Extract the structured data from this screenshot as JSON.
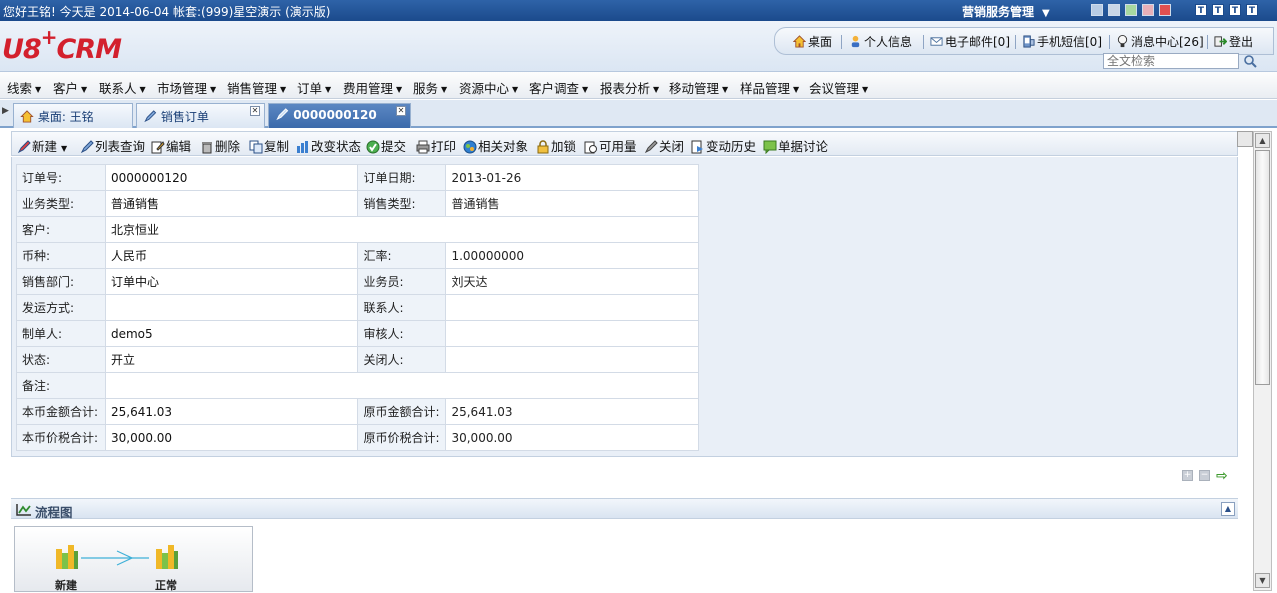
{
  "topbar": {
    "greeting": "您好王铭!   今天是  2014-06-04 帐套:(999)星空演示  (演示版)",
    "module": "营销服务管理",
    "module_arrow": "▼",
    "window_buttons": [
      "T",
      "T",
      "T",
      "T"
    ]
  },
  "header": {
    "logo_main": "U8",
    "logo_plus": "+",
    "logo_crm": "CRM",
    "links": [
      "桌面",
      "个人信息",
      "电子邮件[0]",
      "手机短信[0]",
      "消息中心[26]",
      "登出"
    ],
    "search_placeholder": "全文检索"
  },
  "menu": {
    "items": [
      "线索",
      "客户",
      "联系人",
      "市场管理",
      "销售管理",
      "订单",
      "费用管理",
      "服务",
      "资源中心",
      "客户调查",
      "报表分析",
      "移动管理",
      "样品管理",
      "会议管理"
    ]
  },
  "tabs": [
    {
      "label": "桌面: 王铭"
    },
    {
      "label": "销售订单"
    },
    {
      "label": "0000000120"
    }
  ],
  "toolbar": {
    "items": [
      "新建",
      "列表查询",
      "编辑",
      "删除",
      "复制",
      "改变状态",
      "提交",
      "打印",
      "相关对象",
      "加锁",
      "可用量",
      "关闭",
      "变动历史",
      "单据讨论"
    ]
  },
  "form": {
    "order_no_label": "订单号:",
    "order_no": "0000000120",
    "order_date_label": "订单日期:",
    "order_date": "2013-01-26",
    "biz_type_label": "业务类型:",
    "biz_type": "普通销售",
    "sale_type_label": "销售类型:",
    "sale_type": "普通销售",
    "customer_label": "客户:",
    "customer": "北京恒业",
    "currency_label": "币种:",
    "currency": "人民币",
    "rate_label": "汇率:",
    "rate": "1.00000000",
    "dept_label": "销售部门:",
    "dept": "订单中心",
    "salesman_label": "业务员:",
    "salesman": "刘天达",
    "ship_label": "发运方式:",
    "ship": "",
    "contact_label": "联系人:",
    "contact": "",
    "maker_label": "制单人:",
    "maker": "demo5",
    "auditor_label": "审核人:",
    "auditor": "",
    "status_label": "状态:",
    "status": "开立",
    "closer_label": "关闭人:",
    "closer": "",
    "remark_label": "备注:",
    "remark": "",
    "local_amt_label": "本币金额合计:",
    "local_amt": "25,641.03",
    "orig_amt_label": "原币金额合计:",
    "orig_amt": "25,641.03",
    "local_tax_label": "本币价税合计:",
    "local_tax": "30,000.00",
    "orig_tax_label": "原币价税合计:",
    "orig_tax": "30,000.00"
  },
  "flow": {
    "title": "流程图",
    "nodes": [
      "新建",
      "正常"
    ]
  }
}
